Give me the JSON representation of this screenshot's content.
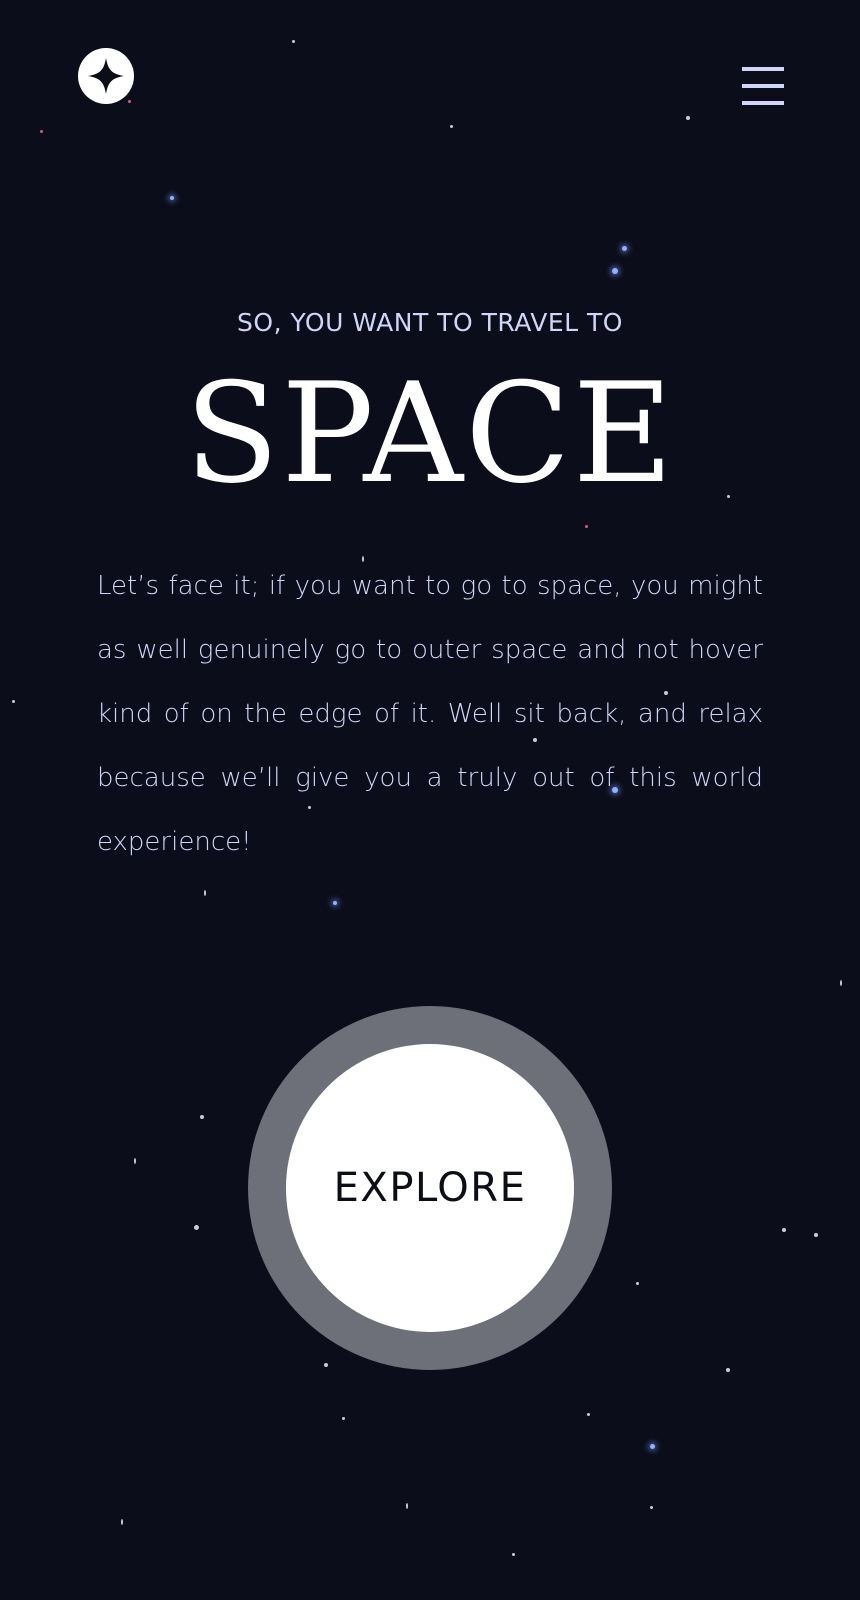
{
  "header": {
    "logo_icon": "compass-star-icon",
    "menu_icon": "hamburger-menu-icon"
  },
  "hero": {
    "kicker": "SO, YOU WANT TO TRAVEL TO",
    "title": "SPACE",
    "description": "Let’s face it; if you want to go to space, you might as well genuinely go to outer space and not hover kind of on the edge of it. Well sit back, and relax because we’ll give you a truly out of this world experience!"
  },
  "cta": {
    "label": "EXPLORE"
  },
  "colors": {
    "background": "#0b0d1a",
    "text_light": "#d0d6f9",
    "white": "#ffffff",
    "ring": "#6d7078"
  }
}
